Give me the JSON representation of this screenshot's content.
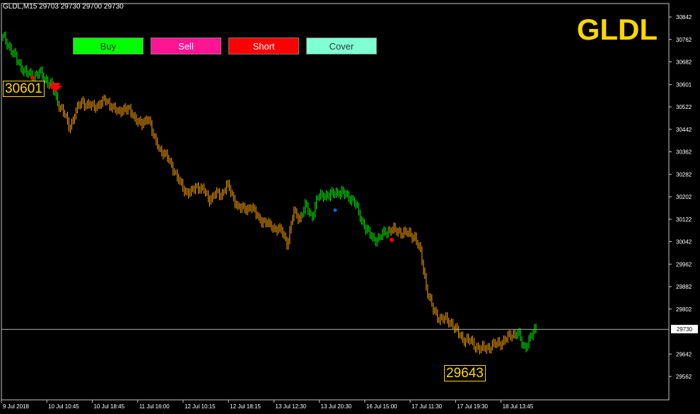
{
  "header": {
    "info": "GLDL,M15  29703 29730 29700 29730"
  },
  "symbol": "GLDL",
  "buttons": [
    {
      "label": "Buy",
      "bg": "#00ff00",
      "fg": "#333333"
    },
    {
      "label": "Sell",
      "bg": "#ff1493",
      "fg": "#ffffff"
    },
    {
      "label": "Short",
      "bg": "#ff0000",
      "fg": "#ffffff"
    },
    {
      "label": "Cover",
      "bg": "#7fffd4",
      "fg": "#333333"
    }
  ],
  "labels": {
    "high": "30601",
    "low": "29643"
  },
  "current_price": "29730",
  "colors": {
    "background": "#000000",
    "up_bars": "#00ff00",
    "down_bars": "#ffa500",
    "text": "#ffffff",
    "accent": "#ffd700"
  },
  "chart_data": {
    "type": "line",
    "title": "GLDL",
    "ylim": [
      29562,
      30842
    ],
    "y_ticks": [
      30842,
      30762,
      30682,
      30601,
      30522,
      30442,
      30362,
      30282,
      30202,
      30122,
      30042,
      29962,
      29882,
      29802,
      29642,
      29562
    ],
    "x_ticks": [
      "9 Jul 2018",
      "10 Jul 10:45",
      "10 Jul 18:45",
      "11 Jul 16:00",
      "12 Jul 10:15",
      "12 Jul 18:15",
      "13 Jul 12:30",
      "13 Jul 20:30",
      "16 Jul 15:00",
      "17 Jul 11:30",
      "17 Jul 19:30",
      "18 Jul 13:45"
    ],
    "grid": false,
    "series": [
      {
        "values": [
          30770,
          30740,
          30700,
          30665,
          30640,
          30630,
          30645,
          30620,
          30601,
          30540,
          30505,
          30445,
          30505,
          30540,
          30530,
          30520,
          30535,
          30545,
          30525,
          30500,
          30520,
          30505,
          30480,
          30455,
          30490,
          30405,
          30370,
          30345,
          30310,
          30260,
          30225,
          30215,
          30240,
          30230,
          30190,
          30215,
          30205,
          30250,
          30195,
          30165,
          30155,
          30170,
          30130,
          30115,
          30100,
          30090,
          30080,
          30035,
          30150,
          30125,
          30170,
          30130,
          30200,
          30210,
          30205,
          30220,
          30215,
          30205,
          30185,
          30130,
          30085,
          30055,
          30050,
          30075,
          30085,
          30080,
          30075,
          30070,
          30060,
          30000,
          29870,
          29800,
          29770,
          29765,
          29755,
          29720,
          29695,
          29690,
          29670,
          29660,
          29665,
          29675,
          29680,
          29695,
          29710,
          29720,
          29660,
          29700,
          29730
        ]
      }
    ]
  }
}
